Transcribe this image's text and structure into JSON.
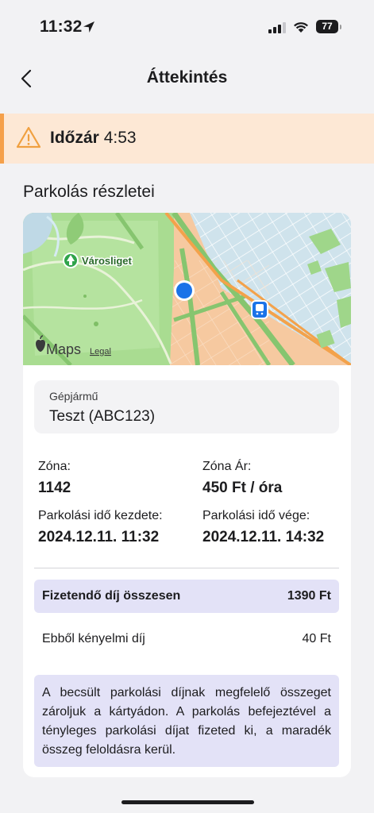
{
  "status_bar": {
    "time": "11:32",
    "battery": "77"
  },
  "nav": {
    "title": "Áttekintés"
  },
  "timer": {
    "label": "Időzár",
    "value": "4:53"
  },
  "section": {
    "title": "Parkolás részletei"
  },
  "map": {
    "place_label": "Városliget",
    "brand": "Maps",
    "legal": "Legal"
  },
  "vehicle": {
    "label": "Gépjármű",
    "value": "Teszt (ABC123)"
  },
  "details": {
    "zone_label": "Zóna:",
    "zone_value": "1142",
    "zone_price_label": "Zóna Ár:",
    "zone_price_value": "450 Ft / óra",
    "start_label": "Parkolási idő kezdete:",
    "start_value": "2024.12.11. 11:32",
    "end_label": "Parkolási idő vége:",
    "end_value": "2024.12.11. 14:32"
  },
  "payment": {
    "total_label": "Fizetendő díj összesen",
    "total_value": "1390 Ft",
    "fee_label": "Ebből kényelmi díj",
    "fee_value": "40 Ft"
  },
  "notice": {
    "text": "A becsült parkolási díjnak megfelelő összeget zároljuk a kártyádon. A parkolás befejeztével a tényleges parkolási díjat fizeted ki, a maradék összeg feloldásra kerül."
  },
  "colors": {
    "timer_bg": "#fde8d5",
    "timer_accent": "#f5a04a",
    "highlight_bg": "#e3e2f7",
    "map_park": "#9fd68a",
    "map_zone": "#f6c9a0",
    "map_water": "#cfe3ec",
    "location_dot": "#1a73e8"
  }
}
